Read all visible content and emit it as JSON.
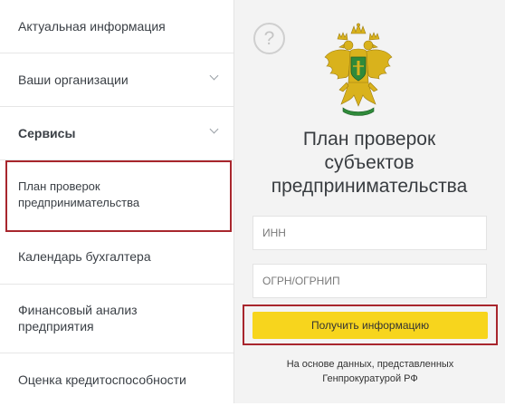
{
  "sidebar": {
    "items": [
      {
        "label": "Актуальная информация"
      },
      {
        "label": "Ваши организации"
      },
      {
        "label": "Сервисы"
      },
      {
        "label_line1": "План проверок",
        "label_line2": "предпринимательства"
      },
      {
        "label": "Календарь бухгалтера"
      },
      {
        "label_line1": "Финансовый анализ",
        "label_line2": "предприятия"
      },
      {
        "label": "Оценка кредитоспособности"
      }
    ]
  },
  "panel": {
    "help_icon_glyph": "?",
    "title_line1": "План проверок",
    "title_line2": "субъектов",
    "title_line3": "предпринимательства",
    "inn_placeholder": "ИНН",
    "ogrn_placeholder": "ОГРН/ОГРНИП",
    "submit_label": "Получить информацию",
    "footnote_line1": "На основе данных, представленных",
    "footnote_line2": "Генпрокуратурой РФ"
  },
  "colors": {
    "accent_yellow": "#f7d51d",
    "highlight_red": "#a8262d",
    "panel_bg": "#f3f3f3"
  },
  "icons": [
    "help-icon",
    "chevron-down-icon",
    "emblem-double-headed-eagle"
  ]
}
